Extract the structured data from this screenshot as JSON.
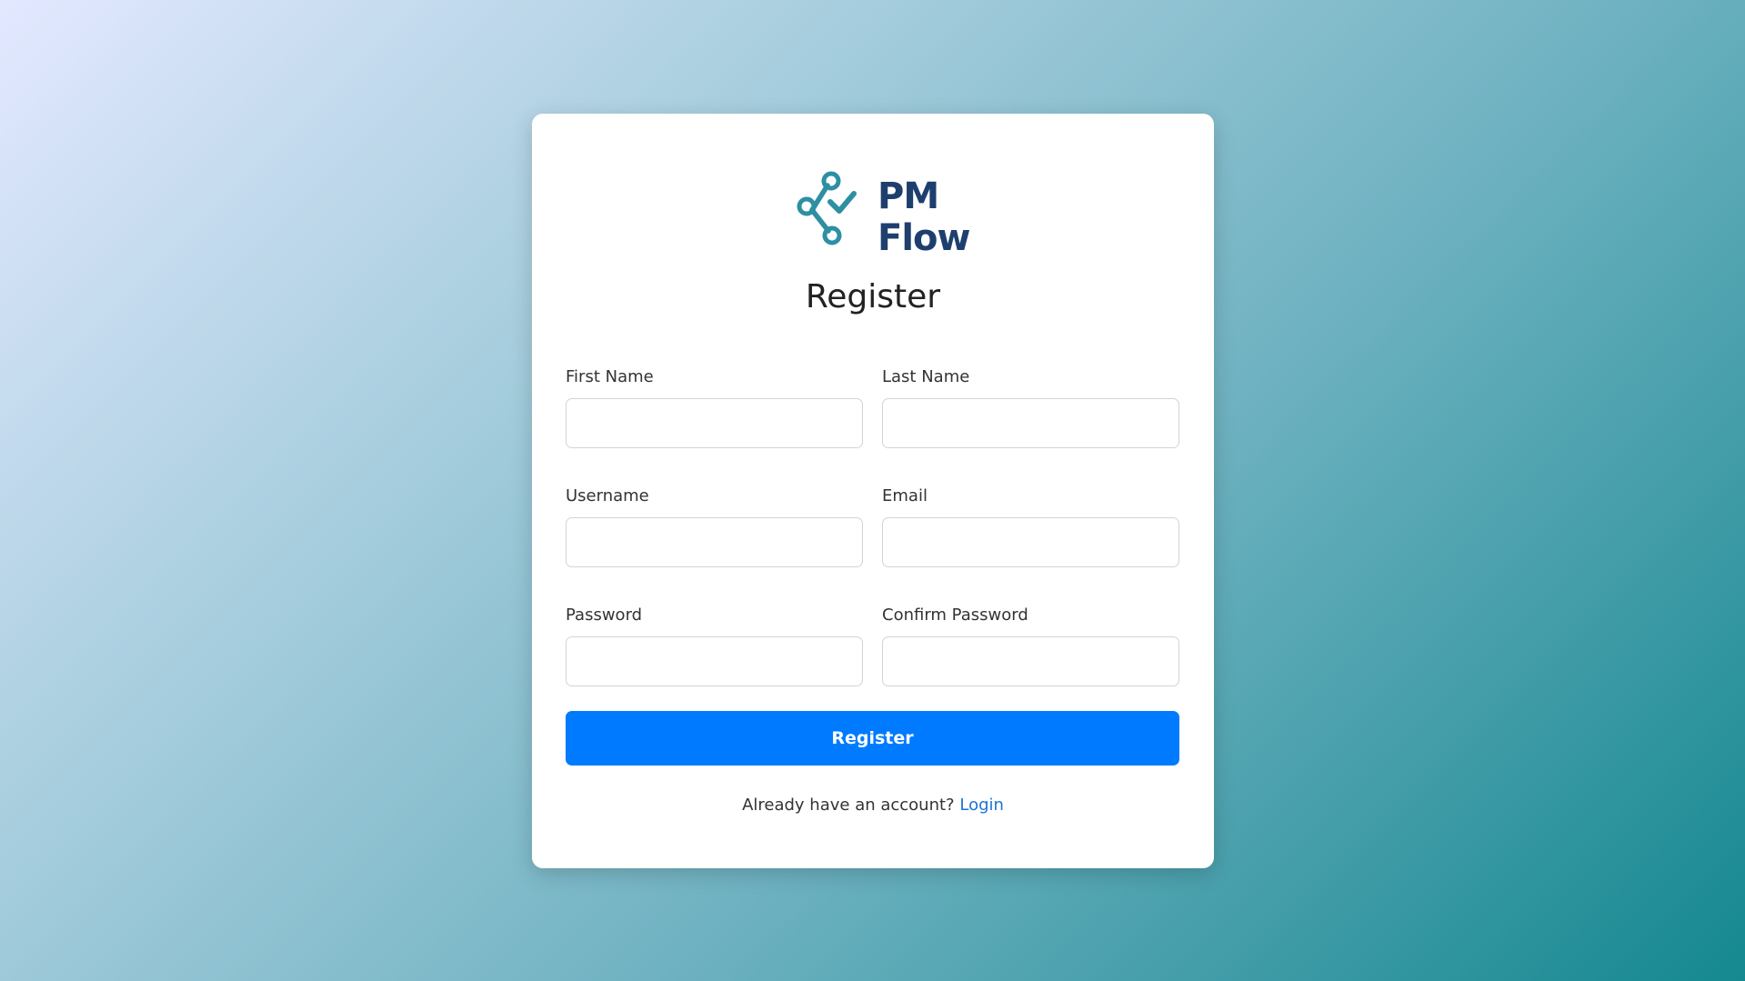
{
  "brand": {
    "line1": "PM",
    "line2": "Flow",
    "logo_icon": "workflow-check-icon"
  },
  "form": {
    "title": "Register",
    "fields": {
      "first_name": {
        "label": "First Name",
        "value": "",
        "placeholder": ""
      },
      "last_name": {
        "label": "Last Name",
        "value": "",
        "placeholder": ""
      },
      "username": {
        "label": "Username",
        "value": "",
        "placeholder": ""
      },
      "email": {
        "label": "Email",
        "value": "",
        "placeholder": ""
      },
      "password": {
        "label": "Password",
        "value": "",
        "placeholder": ""
      },
      "confirm_password": {
        "label": "Confirm Password",
        "value": "",
        "placeholder": ""
      }
    },
    "submit_label": "Register",
    "footer_text": "Already have an account?",
    "login_link": "Login"
  },
  "colors": {
    "primary": "#007bff",
    "brand_dark": "#1e3f6e",
    "brand_teal": "#2e8fa3",
    "link": "#1a73d6"
  }
}
